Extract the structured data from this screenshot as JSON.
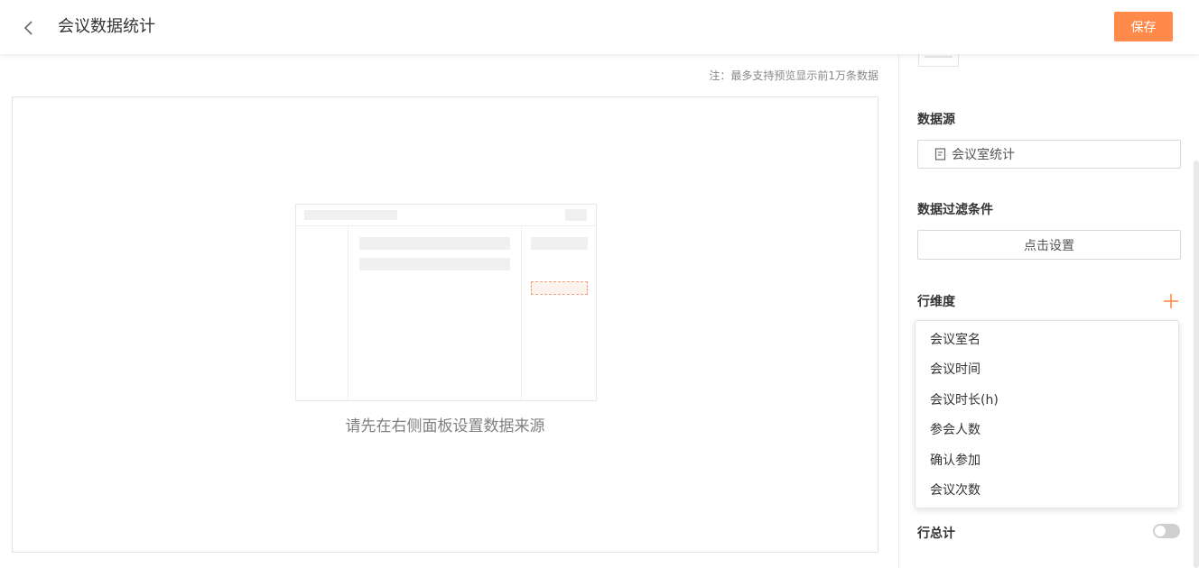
{
  "header": {
    "back_icon": "chevron-left-icon",
    "title": "会议数据统计",
    "save_label": "保存"
  },
  "colors": {
    "accent": "#ff8a4a",
    "border": "#d9d9d9",
    "muted_text": "#808080"
  },
  "preview": {
    "note": "注：最多支持预览显示前1万条数据",
    "empty_hint": "请先在右侧面板设置数据来源"
  },
  "panel": {
    "datasource": {
      "label": "数据源",
      "icon": "document-icon",
      "value": "会议室统计"
    },
    "filter": {
      "label": "数据过滤条件",
      "button_label": "点击设置"
    },
    "row_dimension": {
      "label": "行维度",
      "add_icon": "plus-icon",
      "options": [
        "会议室名",
        "会议时间",
        "会议时长(h)",
        "参会人数",
        "确认参加",
        "会议次数"
      ]
    },
    "row_total": {
      "label": "行总计",
      "enabled": false
    }
  }
}
